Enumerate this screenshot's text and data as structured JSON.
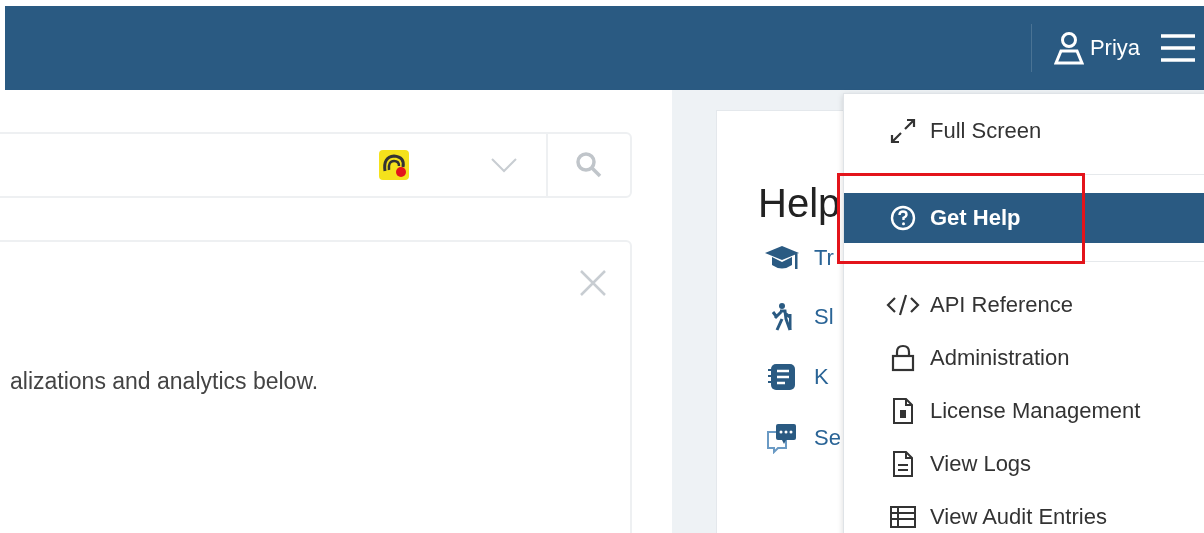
{
  "top_bar": {
    "user": {
      "name": "Priya"
    }
  },
  "welcome_card": {
    "text": "alizations and analytics below."
  },
  "help_card": {
    "title": "Help",
    "links": [
      {
        "kind": "training",
        "label": "Tr"
      },
      {
        "kind": "walkthrough",
        "label": "Sl"
      },
      {
        "kind": "knowledge",
        "label": "K"
      },
      {
        "kind": "support",
        "label": "Se"
      }
    ]
  },
  "menu": {
    "sections": [
      [
        {
          "kind": "fullscreen",
          "label": "Full Screen",
          "selected": false,
          "annotated": false
        }
      ],
      [
        {
          "kind": "help",
          "label": "Get Help",
          "selected": true,
          "annotated": true
        }
      ],
      [
        {
          "kind": "api",
          "label": "API Reference",
          "selected": false,
          "annotated": false
        },
        {
          "kind": "admin",
          "label": "Administration",
          "selected": false,
          "annotated": false
        },
        {
          "kind": "license",
          "label": "License Management",
          "selected": false,
          "annotated": false
        },
        {
          "kind": "logs",
          "label": "View Logs",
          "selected": false,
          "annotated": false
        },
        {
          "kind": "audit",
          "label": "View Audit Entries",
          "selected": false,
          "annotated": false
        }
      ]
    ]
  }
}
